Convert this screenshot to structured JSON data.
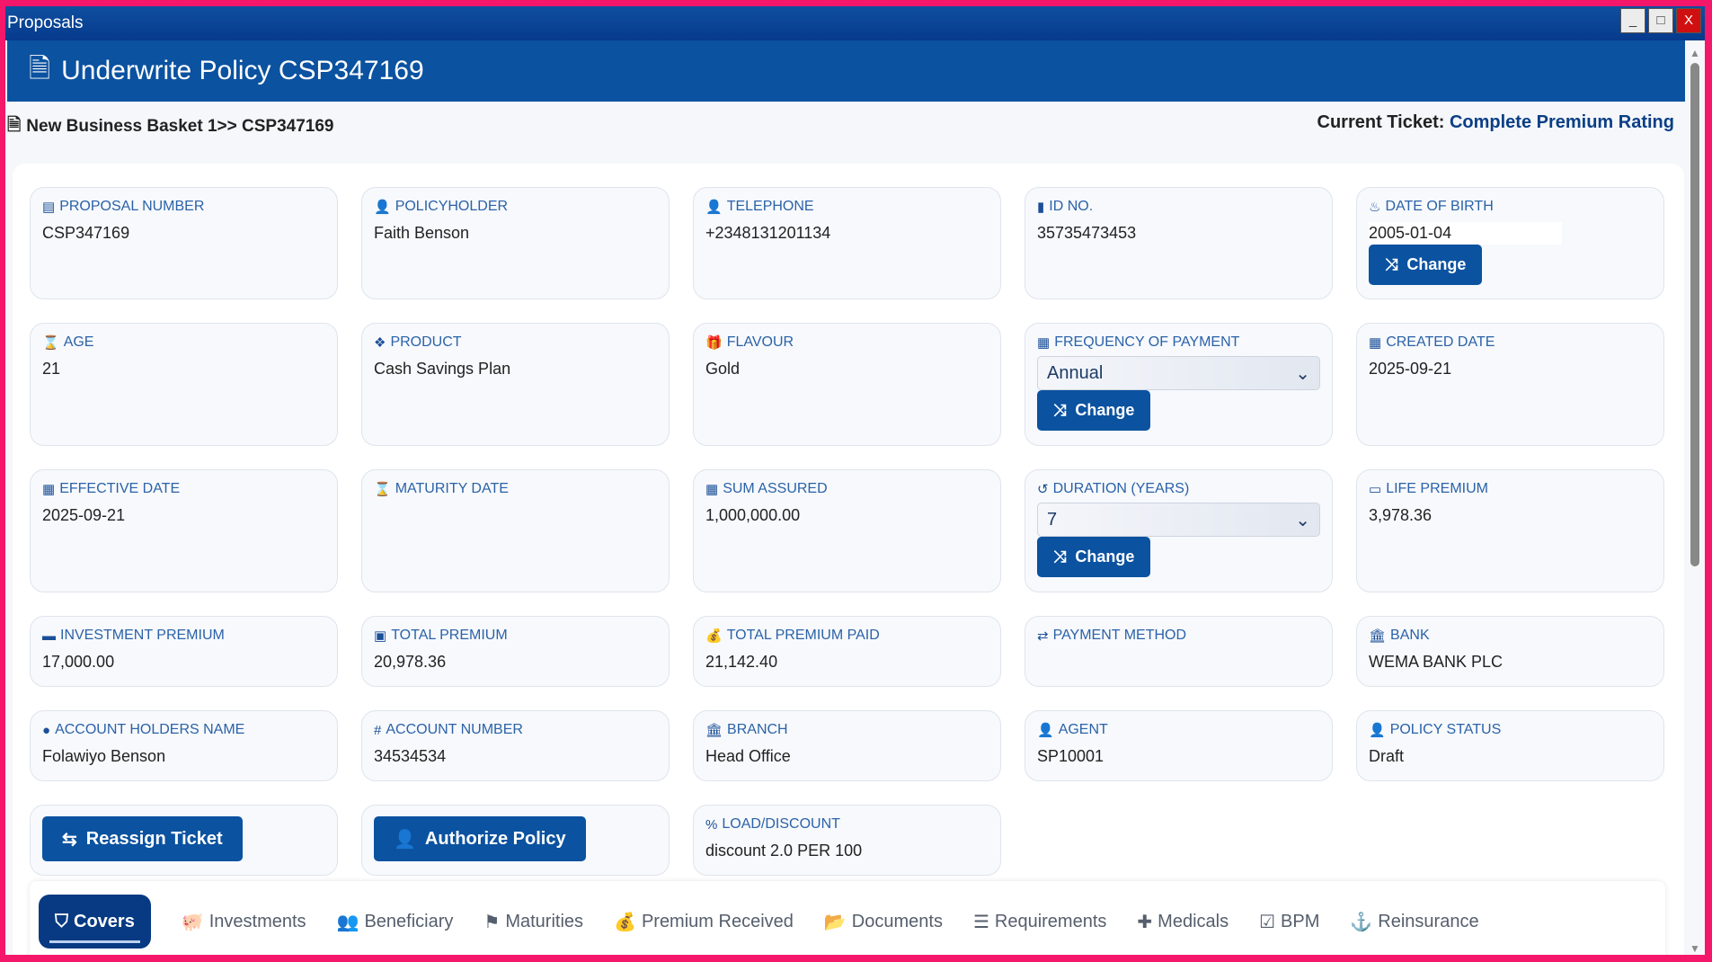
{
  "window": {
    "title": "Proposals",
    "minimize": "_",
    "maximize": "□",
    "close": "X"
  },
  "header": {
    "title": "Underwrite Policy CSP347169"
  },
  "breadcrumb": "New Business Basket 1>> CSP347169",
  "ticket": {
    "label": "Current Ticket:",
    "value": "Complete Premium Rating"
  },
  "fields": {
    "proposal_number": {
      "label": "PROPOSAL NUMBER",
      "value": "CSP347169"
    },
    "policyholder": {
      "label": "POLICYHOLDER",
      "value": "Faith Benson"
    },
    "telephone": {
      "label": "TELEPHONE",
      "value": "+2348131201134"
    },
    "id_no": {
      "label": "ID NO.",
      "value": "35735473453"
    },
    "dob": {
      "label": "DATE OF BIRTH",
      "value": "2005-01-04"
    },
    "age": {
      "label": "AGE",
      "value": "21"
    },
    "product": {
      "label": "PRODUCT",
      "value": "Cash Savings Plan"
    },
    "flavour": {
      "label": "FLAVOUR",
      "value": "Gold"
    },
    "frequency": {
      "label": "FREQUENCY OF PAYMENT",
      "value": "Annual"
    },
    "created": {
      "label": "CREATED DATE",
      "value": "2025-09-21"
    },
    "effective": {
      "label": "EFFECTIVE DATE",
      "value": "2025-09-21"
    },
    "maturity": {
      "label": "MATURITY DATE",
      "value": ""
    },
    "sum_assured": {
      "label": "SUM ASSURED",
      "value": "1,000,000.00"
    },
    "duration": {
      "label": "DURATION (YEARS)",
      "value": "7"
    },
    "life_premium": {
      "label": "LIFE PREMIUM",
      "value": "3,978.36"
    },
    "investment_premium": {
      "label": "INVESTMENT PREMIUM",
      "value": "17,000.00"
    },
    "total_premium": {
      "label": "TOTAL PREMIUM",
      "value": "20,978.36"
    },
    "total_paid": {
      "label": "TOTAL PREMIUM PAID",
      "value": "21,142.40"
    },
    "payment_method": {
      "label": "PAYMENT METHOD",
      "value": ""
    },
    "bank": {
      "label": "BANK",
      "value": "WEMA BANK PLC"
    },
    "account_name": {
      "label": "ACCOUNT HOLDERS NAME",
      "value": "Folawiyo Benson"
    },
    "account_number": {
      "label": "ACCOUNT NUMBER",
      "value": "34534534"
    },
    "branch": {
      "label": "BRANCH",
      "value": "Head Office"
    },
    "agent": {
      "label": "AGENT",
      "value": "SP10001"
    },
    "policy_status": {
      "label": "POLICY STATUS",
      "value": "Draft"
    },
    "load": {
      "label": "LOAD/DISCOUNT",
      "value": "discount 2.0 PER 100"
    }
  },
  "buttons": {
    "change": "Change",
    "reassign": "Reassign Ticket",
    "authorize": "Authorize Policy"
  },
  "tabs": [
    "Covers",
    "Investments",
    "Beneficiary",
    "Maturities",
    "Premium Received",
    "Documents",
    "Requirements",
    "Medicals",
    "BPM",
    "Reinsurance"
  ]
}
